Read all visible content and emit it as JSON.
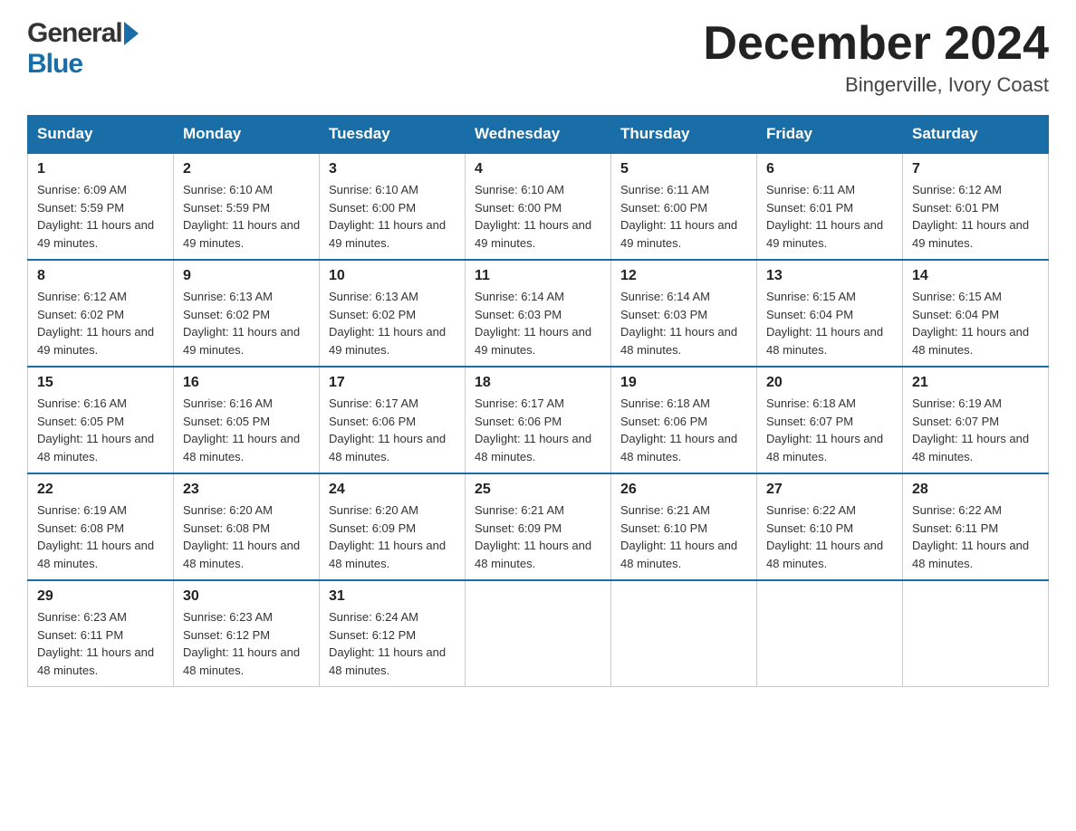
{
  "header": {
    "month_title": "December 2024",
    "location": "Bingerville, Ivory Coast"
  },
  "logo": {
    "general": "General",
    "blue": "Blue"
  },
  "days_of_week": [
    "Sunday",
    "Monday",
    "Tuesday",
    "Wednesday",
    "Thursday",
    "Friday",
    "Saturday"
  ],
  "weeks": [
    [
      {
        "day": "1",
        "sunrise": "Sunrise: 6:09 AM",
        "sunset": "Sunset: 5:59 PM",
        "daylight": "Daylight: 11 hours and 49 minutes."
      },
      {
        "day": "2",
        "sunrise": "Sunrise: 6:10 AM",
        "sunset": "Sunset: 5:59 PM",
        "daylight": "Daylight: 11 hours and 49 minutes."
      },
      {
        "day": "3",
        "sunrise": "Sunrise: 6:10 AM",
        "sunset": "Sunset: 6:00 PM",
        "daylight": "Daylight: 11 hours and 49 minutes."
      },
      {
        "day": "4",
        "sunrise": "Sunrise: 6:10 AM",
        "sunset": "Sunset: 6:00 PM",
        "daylight": "Daylight: 11 hours and 49 minutes."
      },
      {
        "day": "5",
        "sunrise": "Sunrise: 6:11 AM",
        "sunset": "Sunset: 6:00 PM",
        "daylight": "Daylight: 11 hours and 49 minutes."
      },
      {
        "day": "6",
        "sunrise": "Sunrise: 6:11 AM",
        "sunset": "Sunset: 6:01 PM",
        "daylight": "Daylight: 11 hours and 49 minutes."
      },
      {
        "day": "7",
        "sunrise": "Sunrise: 6:12 AM",
        "sunset": "Sunset: 6:01 PM",
        "daylight": "Daylight: 11 hours and 49 minutes."
      }
    ],
    [
      {
        "day": "8",
        "sunrise": "Sunrise: 6:12 AM",
        "sunset": "Sunset: 6:02 PM",
        "daylight": "Daylight: 11 hours and 49 minutes."
      },
      {
        "day": "9",
        "sunrise": "Sunrise: 6:13 AM",
        "sunset": "Sunset: 6:02 PM",
        "daylight": "Daylight: 11 hours and 49 minutes."
      },
      {
        "day": "10",
        "sunrise": "Sunrise: 6:13 AM",
        "sunset": "Sunset: 6:02 PM",
        "daylight": "Daylight: 11 hours and 49 minutes."
      },
      {
        "day": "11",
        "sunrise": "Sunrise: 6:14 AM",
        "sunset": "Sunset: 6:03 PM",
        "daylight": "Daylight: 11 hours and 49 minutes."
      },
      {
        "day": "12",
        "sunrise": "Sunrise: 6:14 AM",
        "sunset": "Sunset: 6:03 PM",
        "daylight": "Daylight: 11 hours and 48 minutes."
      },
      {
        "day": "13",
        "sunrise": "Sunrise: 6:15 AM",
        "sunset": "Sunset: 6:04 PM",
        "daylight": "Daylight: 11 hours and 48 minutes."
      },
      {
        "day": "14",
        "sunrise": "Sunrise: 6:15 AM",
        "sunset": "Sunset: 6:04 PM",
        "daylight": "Daylight: 11 hours and 48 minutes."
      }
    ],
    [
      {
        "day": "15",
        "sunrise": "Sunrise: 6:16 AM",
        "sunset": "Sunset: 6:05 PM",
        "daylight": "Daylight: 11 hours and 48 minutes."
      },
      {
        "day": "16",
        "sunrise": "Sunrise: 6:16 AM",
        "sunset": "Sunset: 6:05 PM",
        "daylight": "Daylight: 11 hours and 48 minutes."
      },
      {
        "day": "17",
        "sunrise": "Sunrise: 6:17 AM",
        "sunset": "Sunset: 6:06 PM",
        "daylight": "Daylight: 11 hours and 48 minutes."
      },
      {
        "day": "18",
        "sunrise": "Sunrise: 6:17 AM",
        "sunset": "Sunset: 6:06 PM",
        "daylight": "Daylight: 11 hours and 48 minutes."
      },
      {
        "day": "19",
        "sunrise": "Sunrise: 6:18 AM",
        "sunset": "Sunset: 6:06 PM",
        "daylight": "Daylight: 11 hours and 48 minutes."
      },
      {
        "day": "20",
        "sunrise": "Sunrise: 6:18 AM",
        "sunset": "Sunset: 6:07 PM",
        "daylight": "Daylight: 11 hours and 48 minutes."
      },
      {
        "day": "21",
        "sunrise": "Sunrise: 6:19 AM",
        "sunset": "Sunset: 6:07 PM",
        "daylight": "Daylight: 11 hours and 48 minutes."
      }
    ],
    [
      {
        "day": "22",
        "sunrise": "Sunrise: 6:19 AM",
        "sunset": "Sunset: 6:08 PM",
        "daylight": "Daylight: 11 hours and 48 minutes."
      },
      {
        "day": "23",
        "sunrise": "Sunrise: 6:20 AM",
        "sunset": "Sunset: 6:08 PM",
        "daylight": "Daylight: 11 hours and 48 minutes."
      },
      {
        "day": "24",
        "sunrise": "Sunrise: 6:20 AM",
        "sunset": "Sunset: 6:09 PM",
        "daylight": "Daylight: 11 hours and 48 minutes."
      },
      {
        "day": "25",
        "sunrise": "Sunrise: 6:21 AM",
        "sunset": "Sunset: 6:09 PM",
        "daylight": "Daylight: 11 hours and 48 minutes."
      },
      {
        "day": "26",
        "sunrise": "Sunrise: 6:21 AM",
        "sunset": "Sunset: 6:10 PM",
        "daylight": "Daylight: 11 hours and 48 minutes."
      },
      {
        "day": "27",
        "sunrise": "Sunrise: 6:22 AM",
        "sunset": "Sunset: 6:10 PM",
        "daylight": "Daylight: 11 hours and 48 minutes."
      },
      {
        "day": "28",
        "sunrise": "Sunrise: 6:22 AM",
        "sunset": "Sunset: 6:11 PM",
        "daylight": "Daylight: 11 hours and 48 minutes."
      }
    ],
    [
      {
        "day": "29",
        "sunrise": "Sunrise: 6:23 AM",
        "sunset": "Sunset: 6:11 PM",
        "daylight": "Daylight: 11 hours and 48 minutes."
      },
      {
        "day": "30",
        "sunrise": "Sunrise: 6:23 AM",
        "sunset": "Sunset: 6:12 PM",
        "daylight": "Daylight: 11 hours and 48 minutes."
      },
      {
        "day": "31",
        "sunrise": "Sunrise: 6:24 AM",
        "sunset": "Sunset: 6:12 PM",
        "daylight": "Daylight: 11 hours and 48 minutes."
      },
      null,
      null,
      null,
      null
    ]
  ]
}
